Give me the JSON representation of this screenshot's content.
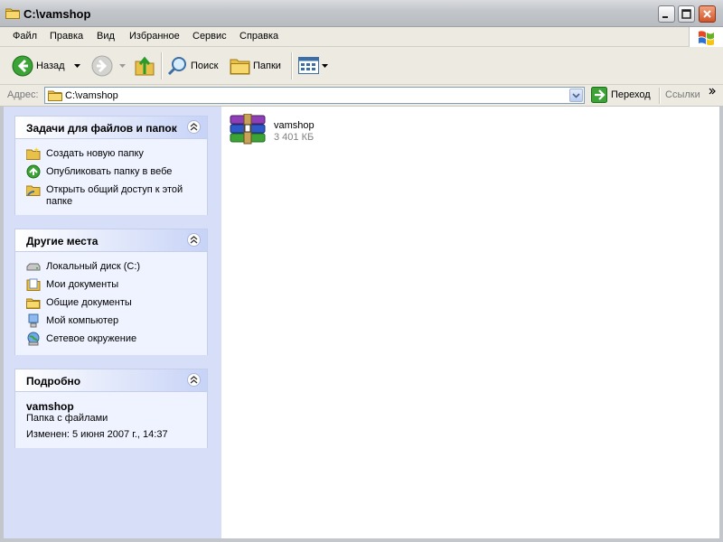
{
  "window": {
    "title": "C:\\vamshop"
  },
  "menu": {
    "items": [
      "Файл",
      "Правка",
      "Вид",
      "Избранное",
      "Сервис",
      "Справка"
    ]
  },
  "toolbar": {
    "back_label": "Назад",
    "search_label": "Поиск",
    "folders_label": "Папки"
  },
  "address": {
    "label": "Адрес:",
    "value": "C:\\vamshop",
    "go_label": "Переход",
    "links_label": "Ссылки"
  },
  "sidebar": {
    "tasks": {
      "title": "Задачи для файлов и папок",
      "items": [
        "Создать новую папку",
        "Опубликовать папку в вебе",
        "Открыть общий доступ к этой папке"
      ]
    },
    "places": {
      "title": "Другие места",
      "items": [
        "Локальный диск (C:)",
        "Мои документы",
        "Общие документы",
        "Мой компьютер",
        "Сетевое окружение"
      ]
    },
    "details": {
      "title": "Подробно",
      "name": "vamshop",
      "type": "Папка с файлами",
      "modified": "Изменен: 5 июня 2007 г., 14:37"
    }
  },
  "files": [
    {
      "name": "vamshop",
      "size": "3 401 КБ",
      "icon": "winrar-archive-icon"
    }
  ]
}
